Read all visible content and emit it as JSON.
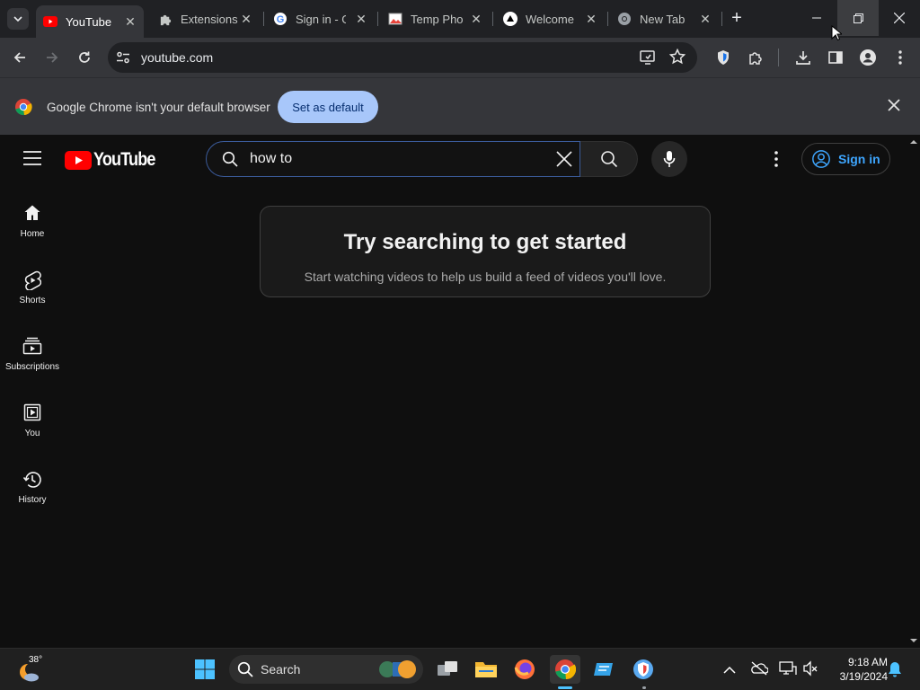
{
  "browser": {
    "tabs": [
      {
        "title": "YouTube",
        "icon": "youtube-favicon",
        "active": true
      },
      {
        "title": "Extensions",
        "icon": "puzzle-icon"
      },
      {
        "title": "Sign in - G",
        "icon": "google-favicon"
      },
      {
        "title": "Temp Pho",
        "icon": "image-favicon"
      },
      {
        "title": "Welcome",
        "icon": "triangle-favicon"
      },
      {
        "title": "New Tab",
        "icon": "chrome-favicon"
      }
    ],
    "url": "youtube.com",
    "infobar": {
      "message": "Google Chrome isn't your default browser",
      "button": "Set as default"
    }
  },
  "youtube": {
    "logo_text": "YouTube",
    "search_value": "how to",
    "sign_in": "Sign in",
    "nav": [
      {
        "label": "Home",
        "icon": "home-icon"
      },
      {
        "label": "Shorts",
        "icon": "shorts-icon"
      },
      {
        "label": "Subscriptions",
        "icon": "subscriptions-icon"
      },
      {
        "label": "You",
        "icon": "you-icon"
      },
      {
        "label": "History",
        "icon": "history-icon"
      }
    ],
    "empty_state": {
      "title": "Try searching to get started",
      "subtitle": "Start watching videos to help us build a feed of videos you'll love."
    }
  },
  "taskbar": {
    "weather_temp": "38°",
    "search_label": "Search",
    "time": "9:18 AM",
    "date": "3/19/2024"
  },
  "colors": {
    "youtube_red": "#ff0000",
    "accent_blue": "#3ea6ff",
    "set_default_bg": "#a8c7fa"
  }
}
